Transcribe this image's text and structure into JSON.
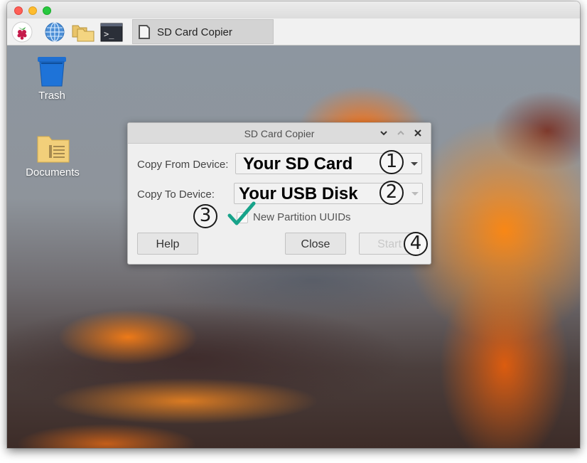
{
  "window": {
    "colors": {
      "traffic_close": "#fe5f57",
      "traffic_min": "#febc2e",
      "traffic_max": "#28c840"
    }
  },
  "taskbar": {
    "launchers": [
      {
        "icon": "raspberry-menu-icon"
      },
      {
        "icon": "web-browser-globe-icon"
      },
      {
        "icon": "file-manager-folders-icon"
      },
      {
        "icon": "terminal-icon"
      }
    ],
    "task": {
      "icon": "sd-card-icon",
      "label": "SD Card Copier"
    }
  },
  "desktop": {
    "icons": [
      {
        "icon": "trash-icon",
        "label": "Trash"
      },
      {
        "icon": "documents-folder-icon",
        "label": "Documents"
      }
    ]
  },
  "dialog": {
    "title": "SD Card Copier",
    "controls": [
      "minimize",
      "maximize",
      "close"
    ],
    "copy_from": {
      "label": "Copy From Device:",
      "value": "Your SD Card"
    },
    "copy_to": {
      "label": "Copy To Device:",
      "value": "Your USB Disk"
    },
    "new_partition_uuids": {
      "label": "New Partition UUIDs",
      "checked": false
    },
    "buttons": {
      "help": "Help",
      "close": "Close",
      "start": "Start"
    }
  },
  "annotations": {
    "step1": "1",
    "step2": "2",
    "step3": "3",
    "step4": "4",
    "checkmark_color": "#17a38a"
  }
}
